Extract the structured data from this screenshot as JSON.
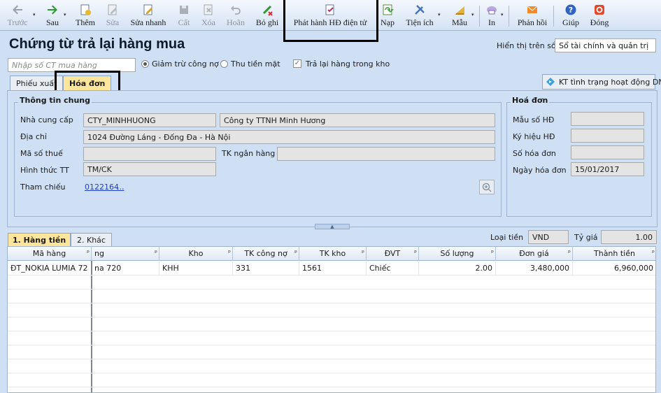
{
  "toolbar": {
    "items": [
      {
        "label": "Trước",
        "icon": "arrow-left-icon",
        "enabled": false
      },
      {
        "label": "Sau",
        "icon": "arrow-right-icon",
        "enabled": true
      },
      {
        "label": "Thêm",
        "icon": "add-document-icon",
        "enabled": true
      },
      {
        "label": "Sửa",
        "icon": "edit-document-icon",
        "enabled": false
      },
      {
        "label": "Sửa nhanh",
        "icon": "quick-edit-icon",
        "enabled": true
      },
      {
        "label": "Cất",
        "icon": "save-icon",
        "enabled": false
      },
      {
        "label": "Xóa",
        "icon": "delete-icon",
        "enabled": false
      },
      {
        "label": "Hoãn",
        "icon": "undo-icon",
        "enabled": false
      },
      {
        "label": "Bỏ ghi",
        "icon": "unpost-icon",
        "enabled": true
      },
      {
        "label": "Phát hành HĐ điện tử",
        "icon": "e-invoice-icon",
        "enabled": true
      },
      {
        "label": "Nạp",
        "icon": "reload-icon",
        "enabled": true
      },
      {
        "label": "Tiện ích",
        "icon": "utilities-icon",
        "enabled": true
      },
      {
        "label": "Mẫu",
        "icon": "template-icon",
        "enabled": true
      },
      {
        "label": "In",
        "icon": "print-icon",
        "enabled": true
      },
      {
        "label": "Phản hồi",
        "icon": "feedback-mail-icon",
        "enabled": true
      },
      {
        "label": "Giúp",
        "icon": "help-icon",
        "enabled": true
      },
      {
        "label": "Đóng",
        "icon": "close-icon",
        "enabled": true
      }
    ]
  },
  "page_title": "Chứng từ trả lại hàng mua",
  "display_on_book": {
    "label": "Hiển thị trên sổ",
    "value": "Sổ tài chính và quản trị"
  },
  "voucher_search_placeholder": "Nhập số CT mua hàng",
  "options": {
    "reduce_debt": "Giảm trừ công nợ",
    "collect_cash": "Thu tiền mặt",
    "return_in_stock": "Trả lại hàng trong kho"
  },
  "tabs": {
    "export_slip": "Phiếu xuất",
    "invoice": "Hóa đơn"
  },
  "status_button": "KT tình trạng hoạt động DN",
  "general": {
    "title": "Thông tin chung",
    "supplier_label": "Nhà cung cấp",
    "supplier_code": "CTY_MINHHUONG",
    "supplier_name": "Công ty TTNH Minh Hương",
    "address_label": "Địa chỉ",
    "address": "1024 Đường Láng - Đống Đa - Hà Nội",
    "tax_code_label": "Mã số thuế",
    "tax_code": "",
    "bank_account_label": "TK ngân hàng",
    "bank_account": "",
    "payment_method_label": "Hình thức TT",
    "payment_method": "TM/CK",
    "reference_label": "Tham chiếu",
    "reference_link": "0122164",
    "reference_more": "..."
  },
  "invoice": {
    "title": "Hoá đơn",
    "template_label": "Mẫu số HĐ",
    "template_value": "",
    "symbol_label": "Ký hiệu HĐ",
    "symbol_value": "",
    "number_label": "Số hóa đơn",
    "number_value": "",
    "date_label": "Ngày hóa đơn",
    "date_value": "15/01/2017"
  },
  "detail_tabs": {
    "goods": "1. Hàng tiền",
    "other": "2. Khác"
  },
  "currency": {
    "label": "Loại tiền",
    "value": "VND"
  },
  "exchange_rate": {
    "label": "Tỷ giá",
    "value": "1.00"
  },
  "grid": {
    "columns": [
      "Mã hàng",
      "ng",
      "Kho",
      "TK công nợ",
      "TK kho",
      "ĐVT",
      "Số lượng",
      "Đơn giá",
      "Thành tiền"
    ],
    "rows": [
      {
        "item_code": "ĐT_NOKIA LUMIA 72",
        "item_name": "na 720",
        "warehouse": "KHH",
        "payable_account": "331",
        "stock_account": "1561",
        "unit": "Chiếc",
        "quantity": "2.00",
        "unit_price": "3,480,000",
        "amount": "6,960,000"
      }
    ]
  }
}
